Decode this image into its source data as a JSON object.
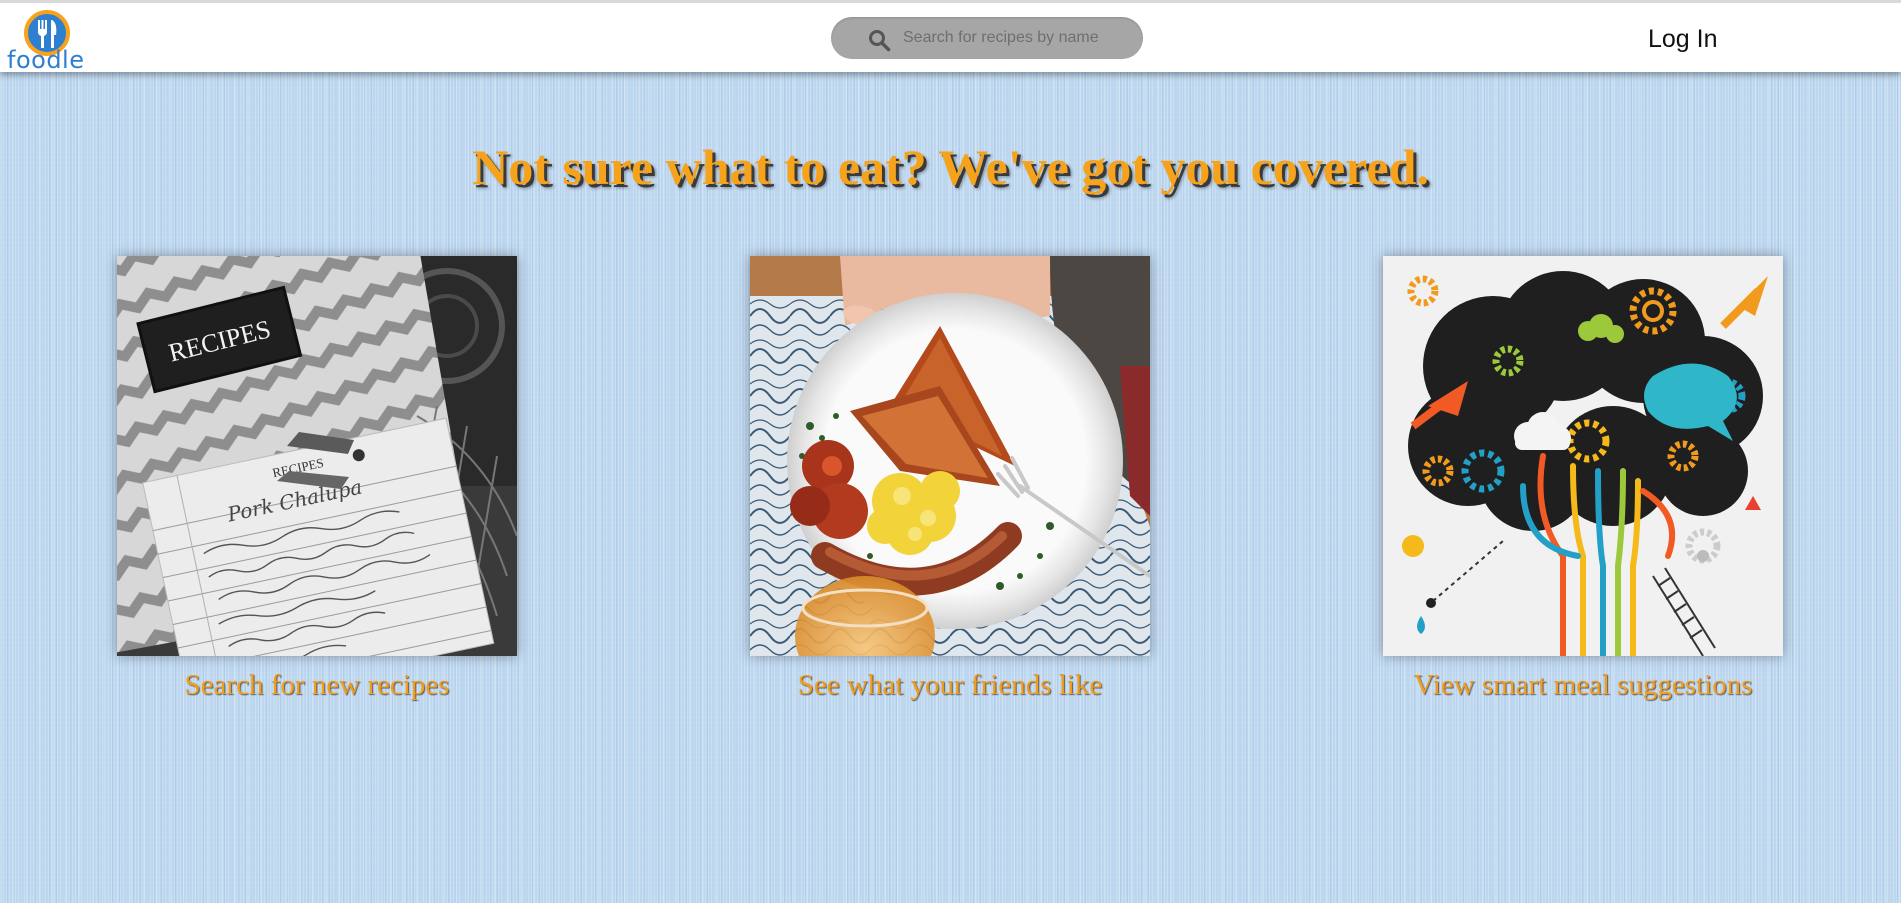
{
  "brand": {
    "name": "foodle",
    "logo_icon": "fork-knife-icon",
    "colors": {
      "ring": "#f6a21a",
      "badge": "#2f7fd0",
      "text": "#2f7fd0"
    }
  },
  "header": {
    "search": {
      "placeholder": "Search for recipes by name",
      "value": "",
      "icon": "search-icon"
    },
    "login_label": "Log In"
  },
  "hero": {
    "title": "Not sure what to eat? We've got you covered.",
    "title_color": "#f6a21a"
  },
  "cards": [
    {
      "caption": "Search for new recipes",
      "image": "recipe-card-photo",
      "image_text": [
        "RECIPES",
        "RECIPES",
        "Pork Chalupa"
      ]
    },
    {
      "caption": "See what your friends like",
      "image": "breakfast-plate-photo"
    },
    {
      "caption": "View smart meal suggestions",
      "image": "smart-brain-illustration"
    }
  ],
  "theme": {
    "background": "#bcd6ef",
    "caption_color": "#f29d1e"
  }
}
